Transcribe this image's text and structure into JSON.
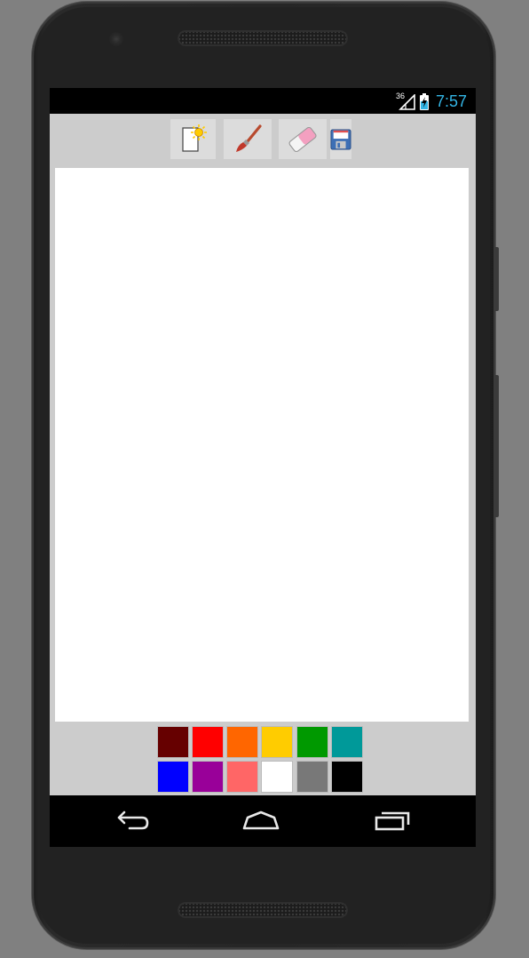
{
  "status_bar": {
    "network_label": "36",
    "time": "7:57",
    "clock_color": "#33b5e5",
    "icons": [
      "signal-icon",
      "battery-charging-icon"
    ]
  },
  "toolbar": {
    "buttons": [
      {
        "name": "new-drawing-button",
        "icon": "new-document-icon"
      },
      {
        "name": "brush-button",
        "icon": "paint-brush-icon"
      },
      {
        "name": "eraser-button",
        "icon": "eraser-icon"
      },
      {
        "name": "save-button",
        "icon": "floppy-disk-icon"
      }
    ]
  },
  "canvas": {
    "background": "#ffffff"
  },
  "palette": {
    "rows": [
      [
        "#660000",
        "#ff0000",
        "#ff6600",
        "#ffcc00",
        "#009900",
        "#009999"
      ],
      [
        "#0000ff",
        "#990099",
        "#ff6666",
        "#ffffff",
        "#787878",
        "#000000"
      ]
    ]
  },
  "nav_bar": {
    "buttons": [
      "back-icon",
      "home-icon",
      "recents-icon"
    ]
  }
}
